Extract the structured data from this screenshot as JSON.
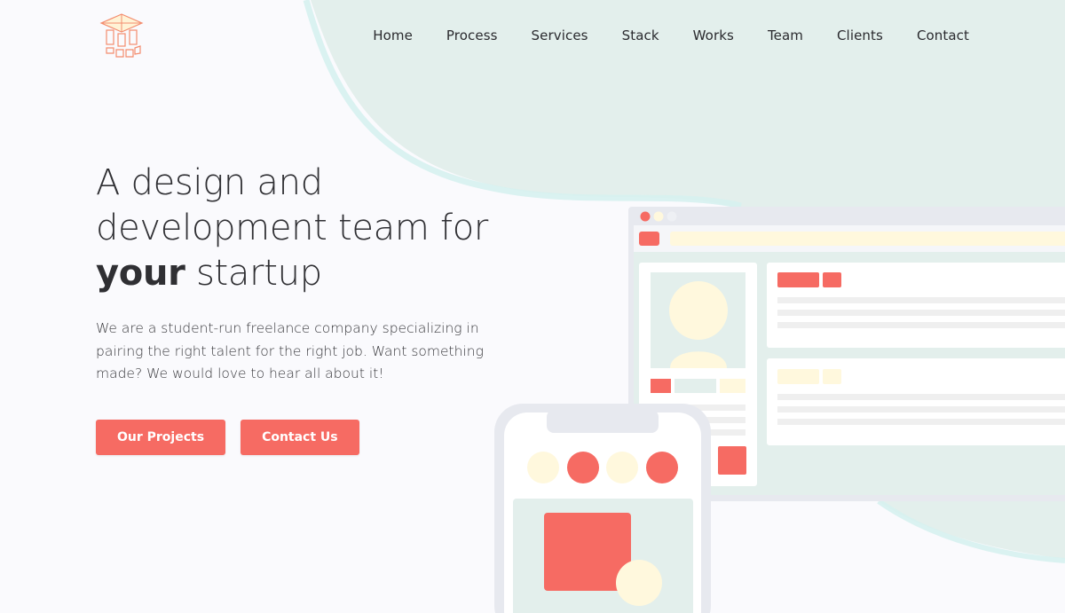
{
  "colors": {
    "accent": "#f66b63",
    "mint": "#e3efec",
    "cream": "#fff8dd",
    "page_bg": "#fafafd"
  },
  "logo": {
    "icon": "building-cube-logo-icon"
  },
  "nav": {
    "items": [
      {
        "label": "Home"
      },
      {
        "label": "Process"
      },
      {
        "label": "Services"
      },
      {
        "label": "Stack"
      },
      {
        "label": "Works"
      },
      {
        "label": "Team"
      },
      {
        "label": "Clients"
      },
      {
        "label": "Contact"
      }
    ]
  },
  "hero": {
    "title_line1": "A design and",
    "title_line2": "development team for",
    "title_bold": "your",
    "title_rest": " startup",
    "description": "We are a student-run freelance company specializing in pairing the right talent for the right job. Want something made? We would love to hear all about it!"
  },
  "buttons": {
    "projects": "Our Projects",
    "contact": "Contact Us"
  }
}
